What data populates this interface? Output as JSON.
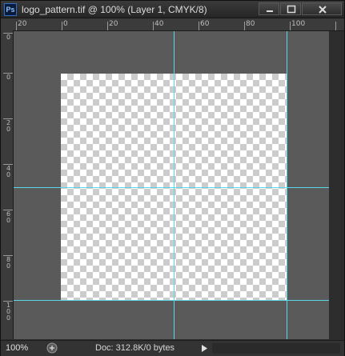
{
  "window": {
    "app_icon_text": "Ps",
    "title": "logo_pattern.tif @ 100% (Layer 1, CMYK/8)"
  },
  "ruler": {
    "top_labels": [
      "20",
      "0",
      "20",
      "40",
      "60",
      "80",
      "100"
    ],
    "left_labels": [
      "0",
      "0",
      "2 0",
      "4 0",
      "6 0",
      "8 0",
      "1 0 0"
    ]
  },
  "canvas": {
    "background": "transparent-checkerboard",
    "guide_color": "#5ad7e6",
    "pasteboard_color": "#5a5a5a"
  },
  "status": {
    "zoom": "100%",
    "doc_info": "Doc: 312.8K/0 bytes"
  },
  "icons": {
    "app": "photoshop-icon",
    "minimize": "minimize-icon",
    "maximize": "maximize-icon",
    "close": "close-icon",
    "zoom_menu": "zoom-menu-icon",
    "status_menu": "play-arrow-icon"
  }
}
